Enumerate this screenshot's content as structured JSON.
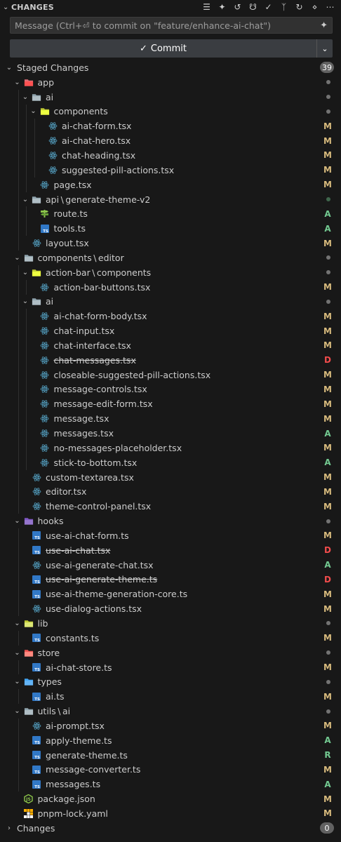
{
  "header": {
    "title": "CHANGES"
  },
  "message": {
    "placeholder": "Message (Ctrl+⏎ to commit on \"feature/enhance-ai-chat\")",
    "value": ""
  },
  "commit": {
    "label": "Commit"
  },
  "sections": {
    "staged": {
      "label": "Staged Changes",
      "count": "39"
    },
    "changes": {
      "label": "Changes",
      "count": "0"
    }
  },
  "colors": {
    "modified": "#d7ba7d",
    "added": "#73c991",
    "deleted": "#f14c4c",
    "renamed": "#73c991",
    "react": "#519aba",
    "typescript": "#3178c6"
  },
  "tree": [
    {
      "depth": 1,
      "kind": "folder",
      "icon": "app-folder-icon",
      "label": "app",
      "dot": true
    },
    {
      "depth": 2,
      "kind": "folder",
      "icon": "ai-folder-icon",
      "label": "ai",
      "dot": true
    },
    {
      "depth": 3,
      "kind": "folder",
      "icon": "components-folder-icon",
      "label": "components",
      "dot": true
    },
    {
      "depth": 4,
      "kind": "file",
      "icon": "react-icon",
      "label": "ai-chat-form.tsx",
      "status": "M"
    },
    {
      "depth": 4,
      "kind": "file",
      "icon": "react-icon",
      "label": "ai-chat-hero.tsx",
      "status": "M"
    },
    {
      "depth": 4,
      "kind": "file",
      "icon": "react-icon",
      "label": "chat-heading.tsx",
      "status": "M"
    },
    {
      "depth": 4,
      "kind": "file",
      "icon": "react-icon",
      "label": "suggested-pill-actions.tsx",
      "status": "M"
    },
    {
      "depth": 3,
      "kind": "file",
      "icon": "react-icon",
      "label": "page.tsx",
      "status": "M"
    },
    {
      "depth": 2,
      "kind": "folder",
      "icon": "api-folder-icon",
      "label": "api \\ generate-theme-v2",
      "dot": true,
      "dotGreen": true
    },
    {
      "depth": 3,
      "kind": "file",
      "icon": "route-icon",
      "label": "route.ts",
      "status": "A"
    },
    {
      "depth": 3,
      "kind": "file",
      "icon": "typescript-icon",
      "label": "tools.ts",
      "status": "A"
    },
    {
      "depth": 2,
      "kind": "file",
      "icon": "react-icon",
      "label": "layout.tsx",
      "status": "M"
    },
    {
      "depth": 1,
      "kind": "folder",
      "icon": "folder-icon",
      "label": "components \\ editor",
      "dot": true
    },
    {
      "depth": 2,
      "kind": "folder",
      "icon": "components-folder-icon",
      "label": "action-bar \\ components",
      "dot": true
    },
    {
      "depth": 3,
      "kind": "file",
      "icon": "react-icon",
      "label": "action-bar-buttons.tsx",
      "status": "M"
    },
    {
      "depth": 2,
      "kind": "folder",
      "icon": "ai-folder-icon",
      "label": "ai",
      "dot": true
    },
    {
      "depth": 3,
      "kind": "file",
      "icon": "react-icon",
      "label": "ai-chat-form-body.tsx",
      "status": "M"
    },
    {
      "depth": 3,
      "kind": "file",
      "icon": "react-icon",
      "label": "chat-input.tsx",
      "status": "M"
    },
    {
      "depth": 3,
      "kind": "file",
      "icon": "react-icon",
      "label": "chat-interface.tsx",
      "status": "M"
    },
    {
      "depth": 3,
      "kind": "file",
      "icon": "react-icon",
      "label": "chat-messages.tsx",
      "status": "D",
      "deleted": true
    },
    {
      "depth": 3,
      "kind": "file",
      "icon": "react-icon",
      "label": "closeable-suggested-pill-actions.tsx",
      "status": "M"
    },
    {
      "depth": 3,
      "kind": "file",
      "icon": "react-icon",
      "label": "message-controls.tsx",
      "status": "M"
    },
    {
      "depth": 3,
      "kind": "file",
      "icon": "react-icon",
      "label": "message-edit-form.tsx",
      "status": "M"
    },
    {
      "depth": 3,
      "kind": "file",
      "icon": "react-icon",
      "label": "message.tsx",
      "status": "M"
    },
    {
      "depth": 3,
      "kind": "file",
      "icon": "react-icon",
      "label": "messages.tsx",
      "status": "A"
    },
    {
      "depth": 3,
      "kind": "file",
      "icon": "react-icon",
      "label": "no-messages-placeholder.tsx",
      "status": "M"
    },
    {
      "depth": 3,
      "kind": "file",
      "icon": "react-icon",
      "label": "stick-to-bottom.tsx",
      "status": "A"
    },
    {
      "depth": 2,
      "kind": "file",
      "icon": "react-icon",
      "label": "custom-textarea.tsx",
      "status": "M"
    },
    {
      "depth": 2,
      "kind": "file",
      "icon": "react-icon",
      "label": "editor.tsx",
      "status": "M"
    },
    {
      "depth": 2,
      "kind": "file",
      "icon": "react-icon",
      "label": "theme-control-panel.tsx",
      "status": "M"
    },
    {
      "depth": 1,
      "kind": "folder",
      "icon": "hooks-folder-icon",
      "label": "hooks",
      "dot": true
    },
    {
      "depth": 2,
      "kind": "file",
      "icon": "typescript-icon",
      "label": "use-ai-chat-form.ts",
      "status": "M"
    },
    {
      "depth": 2,
      "kind": "file",
      "icon": "typescript-icon",
      "label": "use-ai-chat.tsx",
      "status": "D",
      "deleted": true
    },
    {
      "depth": 2,
      "kind": "file",
      "icon": "react-icon",
      "label": "use-ai-generate-chat.tsx",
      "status": "A"
    },
    {
      "depth": 2,
      "kind": "file",
      "icon": "typescript-icon",
      "label": "use-ai-generate-theme.ts",
      "status": "D",
      "deleted": true
    },
    {
      "depth": 2,
      "kind": "file",
      "icon": "typescript-icon",
      "label": "use-ai-theme-generation-core.ts",
      "status": "M"
    },
    {
      "depth": 2,
      "kind": "file",
      "icon": "react-icon",
      "label": "use-dialog-actions.tsx",
      "status": "M"
    },
    {
      "depth": 1,
      "kind": "folder",
      "icon": "lib-folder-icon",
      "label": "lib",
      "dot": true
    },
    {
      "depth": 2,
      "kind": "file",
      "icon": "typescript-icon",
      "label": "constants.ts",
      "status": "M"
    },
    {
      "depth": 1,
      "kind": "folder",
      "icon": "store-folder-icon",
      "label": "store",
      "dot": true
    },
    {
      "depth": 2,
      "kind": "file",
      "icon": "typescript-icon",
      "label": "ai-chat-store.ts",
      "status": "M"
    },
    {
      "depth": 1,
      "kind": "folder",
      "icon": "types-folder-icon",
      "label": "types",
      "dot": true
    },
    {
      "depth": 2,
      "kind": "file",
      "icon": "typescript-icon",
      "label": "ai.ts",
      "status": "M"
    },
    {
      "depth": 1,
      "kind": "folder",
      "icon": "folder-icon",
      "label": "utils \\ ai",
      "dot": true
    },
    {
      "depth": 2,
      "kind": "file",
      "icon": "react-icon",
      "label": "ai-prompt.tsx",
      "status": "M"
    },
    {
      "depth": 2,
      "kind": "file",
      "icon": "typescript-icon",
      "label": "apply-theme.ts",
      "status": "A"
    },
    {
      "depth": 2,
      "kind": "file",
      "icon": "typescript-icon",
      "label": "generate-theme.ts",
      "status": "R"
    },
    {
      "depth": 2,
      "kind": "file",
      "icon": "typescript-icon",
      "label": "message-converter.ts",
      "status": "M"
    },
    {
      "depth": 2,
      "kind": "file",
      "icon": "typescript-icon",
      "label": "messages.ts",
      "status": "A"
    },
    {
      "depth": 1,
      "kind": "file",
      "icon": "nodejs-icon",
      "label": "package.json",
      "status": "M"
    },
    {
      "depth": 1,
      "kind": "file",
      "icon": "pnpm-icon",
      "label": "pnpm-lock.yaml",
      "status": "M"
    }
  ]
}
